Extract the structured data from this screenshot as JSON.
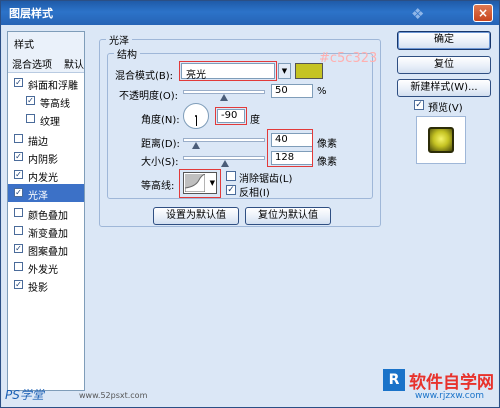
{
  "window": {
    "title": "图层样式",
    "close": "×",
    "logo": "❖"
  },
  "left_panel": {
    "header_styles": "样式",
    "header_blend": "混合选项",
    "header_blend_suffix": "默认",
    "items": [
      {
        "label": "斜面和浮雕",
        "checked": true
      },
      {
        "label": "等高线",
        "checked": true
      },
      {
        "label": "纹理",
        "checked": false
      },
      {
        "label": "描边",
        "checked": false
      },
      {
        "label": "内阴影",
        "checked": true
      },
      {
        "label": "内发光",
        "checked": true
      },
      {
        "label": "光泽",
        "checked": true,
        "selected": true
      },
      {
        "label": "颜色叠加",
        "checked": false
      },
      {
        "label": "渐变叠加",
        "checked": false
      },
      {
        "label": "图案叠加",
        "checked": true
      },
      {
        "label": "外发光",
        "checked": false
      },
      {
        "label": "投影",
        "checked": true
      }
    ]
  },
  "satin": {
    "group_title": "光泽",
    "structure_title": "结构",
    "blend_mode_label": "混合模式(B):",
    "blend_mode_value": "亮光",
    "color": "#c5c323",
    "color_annotation": "#c5c323",
    "opacity_label": "不透明度(O):",
    "opacity_value": "50",
    "opacity_unit": "%",
    "opacity_percent": 50,
    "angle_label": "角度(N):",
    "angle_value": "-90",
    "angle_unit": "度",
    "distance_label": "距离(D):",
    "distance_value": "40",
    "distance_unit": "像素",
    "distance_fraction": 0.16,
    "size_label": "大小(S):",
    "size_value": "128",
    "size_unit": "像素",
    "size_fraction": 0.51,
    "contour_label": "等高线:",
    "antialias_label": "消除锯齿(L)",
    "antialias_checked": false,
    "invert_label": "反相(I)",
    "invert_checked": true,
    "set_default": "设置为默认值",
    "reset_default": "复位为默认值"
  },
  "right_buttons": {
    "ok": "确定",
    "reset": "复位",
    "new_style": "新建样式(W)...",
    "preview_label": "预览(V)",
    "preview_checked": true
  },
  "watermarks": {
    "bottom_left": "PS学堂",
    "bottom_url": "www.52psxt.com",
    "brand": "软件自学网",
    "brand_url": "www.rjzxw.com"
  }
}
